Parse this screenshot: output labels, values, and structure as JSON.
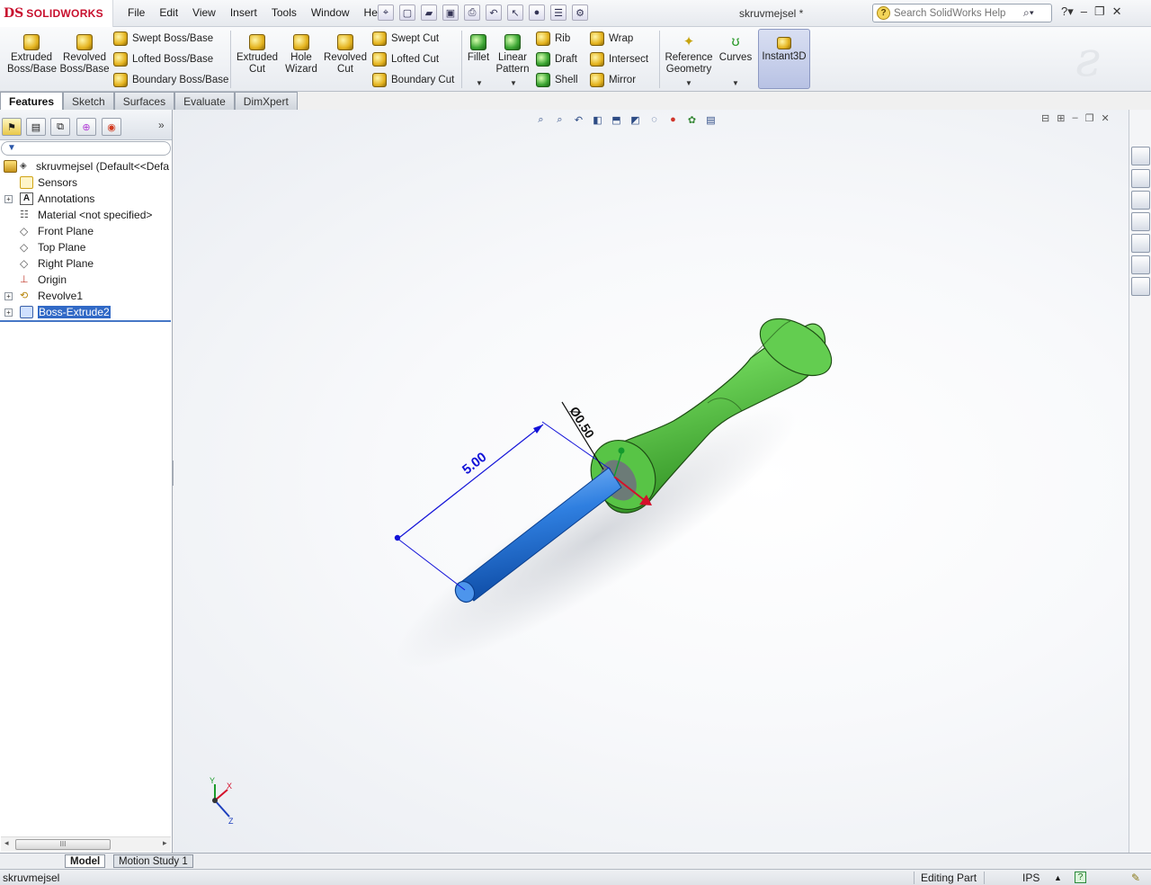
{
  "app": {
    "brand_symbol": "DS",
    "brand": "SOLIDWORKS",
    "doc_title": "skruvmejsel *"
  },
  "menu": [
    "File",
    "Edit",
    "View",
    "Insert",
    "Tools",
    "Window",
    "Help"
  ],
  "search": {
    "placeholder": "Search SolidWorks Help"
  },
  "commands": {
    "extruded_boss": "Extruded Boss/Base",
    "revolved_boss": "Revolved Boss/Base",
    "swept_boss": "Swept Boss/Base",
    "lofted_boss": "Lofted Boss/Base",
    "boundary_boss": "Boundary Boss/Base",
    "extruded_cut": "Extruded Cut",
    "hole_wizard": "Hole Wizard",
    "revolved_cut": "Revolved Cut",
    "swept_cut": "Swept Cut",
    "lofted_cut": "Lofted Cut",
    "boundary_cut": "Boundary Cut",
    "fillet": "Fillet",
    "linear_pattern": "Linear Pattern",
    "rib": "Rib",
    "draft": "Draft",
    "shell": "Shell",
    "wrap": "Wrap",
    "intersect": "Intersect",
    "mirror": "Mirror",
    "reference_geometry": "Reference Geometry",
    "curves": "Curves",
    "instant3d": "Instant3D"
  },
  "cm_tabs": [
    "Features",
    "Sketch",
    "Surfaces",
    "Evaluate",
    "DimXpert"
  ],
  "tree": {
    "root": "skruvmejsel  (Default<<Defa",
    "items": [
      {
        "label": "Sensors",
        "icon": "sensors-icon",
        "expandable": false
      },
      {
        "label": "Annotations",
        "icon": "annotations-icon",
        "expandable": true
      },
      {
        "label": "Material <not specified>",
        "icon": "material-icon",
        "expandable": false
      },
      {
        "label": "Front Plane",
        "icon": "plane-icon",
        "expandable": false
      },
      {
        "label": "Top Plane",
        "icon": "plane-icon",
        "expandable": false
      },
      {
        "label": "Right Plane",
        "icon": "plane-icon",
        "expandable": false
      },
      {
        "label": "Origin",
        "icon": "origin-icon",
        "expandable": false
      },
      {
        "label": "Revolve1",
        "icon": "revolve-icon",
        "expandable": true
      },
      {
        "label": "Boss-Extrude2",
        "icon": "extrude-icon",
        "expandable": true,
        "selected": true
      }
    ]
  },
  "dimensions": {
    "length": "5.00",
    "diameter": "Ø0.50"
  },
  "triad": {
    "x": "X",
    "y": "Y",
    "z": "Z"
  },
  "bottom_tabs": [
    "Model",
    "Motion Study 1"
  ],
  "status": {
    "doc": "skruvmejsel",
    "mode": "Editing Part",
    "units": "IPS",
    "help_symbol": "?"
  },
  "colors": {
    "handle": "#4cc43a",
    "shaft": "#2f7fe0",
    "dimension": "#1212d8",
    "selection": "#3169c6"
  }
}
